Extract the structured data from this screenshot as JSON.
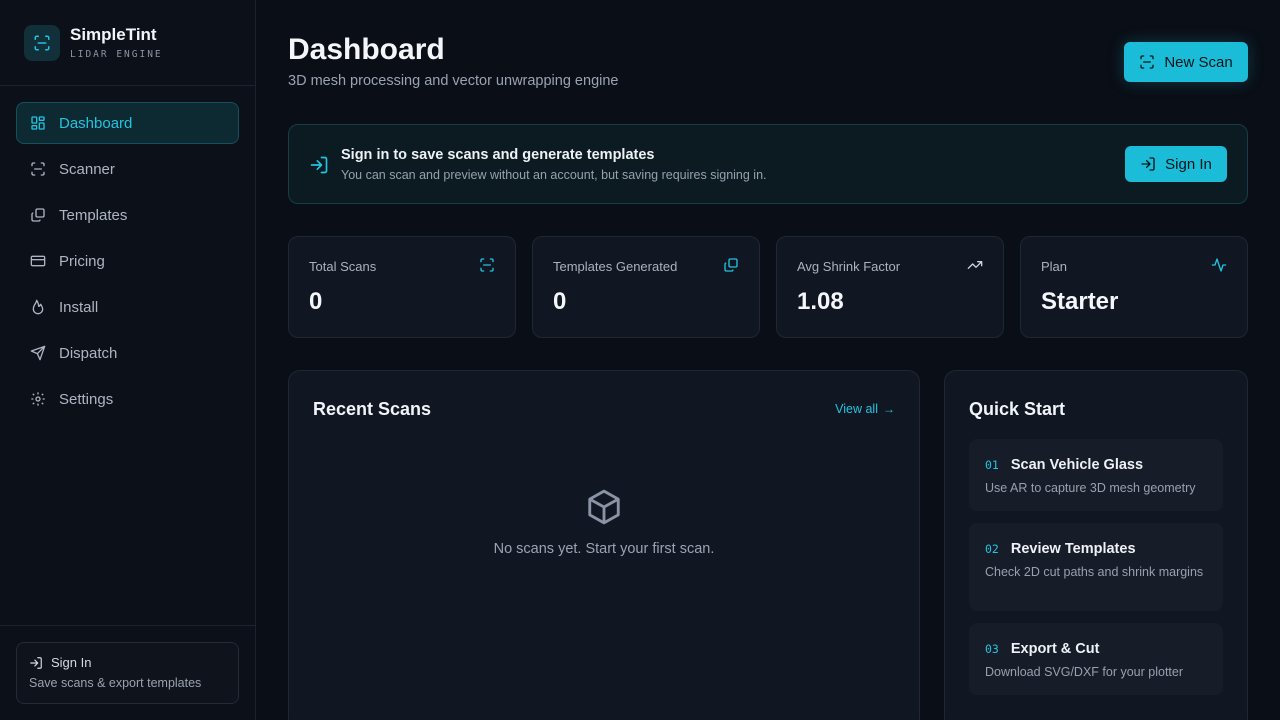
{
  "brand": {
    "name": "SimpleTint",
    "subtitle": "LIDAR ENGINE"
  },
  "sidebar": {
    "items": [
      {
        "label": "Dashboard",
        "icon": "grid-icon",
        "active": true
      },
      {
        "label": "Scanner",
        "icon": "scan-icon"
      },
      {
        "label": "Templates",
        "icon": "copy-icon"
      },
      {
        "label": "Pricing",
        "icon": "credit-card-icon"
      },
      {
        "label": "Install",
        "icon": "flame-icon"
      },
      {
        "label": "Dispatch",
        "icon": "send-icon"
      },
      {
        "label": "Settings",
        "icon": "gear-icon"
      }
    ],
    "sign_in": {
      "label": "Sign In",
      "subtitle": "Save scans & export templates"
    }
  },
  "header": {
    "title": "Dashboard",
    "subtitle": "3D mesh processing and vector unwrapping engine",
    "new_scan_label": "New Scan"
  },
  "banner": {
    "title": "Sign in to save scans and generate templates",
    "subtitle": "You can scan and preview without an account, but saving requires signing in.",
    "button_label": "Sign In"
  },
  "stats": [
    {
      "label": "Total Scans",
      "value": "0",
      "icon": "scan-icon"
    },
    {
      "label": "Templates Generated",
      "value": "0",
      "icon": "copy-icon"
    },
    {
      "label": "Avg Shrink Factor",
      "value": "1.08",
      "icon": "trending-up-icon"
    },
    {
      "label": "Plan",
      "value": "Starter",
      "icon": "activity-icon"
    }
  ],
  "recent_scans": {
    "title": "Recent Scans",
    "view_all_label": "View all",
    "empty_text": "No scans yet. Start your first scan."
  },
  "quick_start": {
    "title": "Quick Start",
    "items": [
      {
        "num": "01",
        "title": "Scan Vehicle Glass",
        "desc": "Use AR to capture 3D mesh geometry"
      },
      {
        "num": "02",
        "title": "Review Templates",
        "desc": "Check 2D cut paths and shrink margins"
      },
      {
        "num": "03",
        "title": "Export & Cut",
        "desc": "Download SVG/DXF for your plotter"
      }
    ]
  },
  "colors": {
    "accent": "#1bbcd8",
    "background": "#0a0e16",
    "card": "#111722"
  }
}
